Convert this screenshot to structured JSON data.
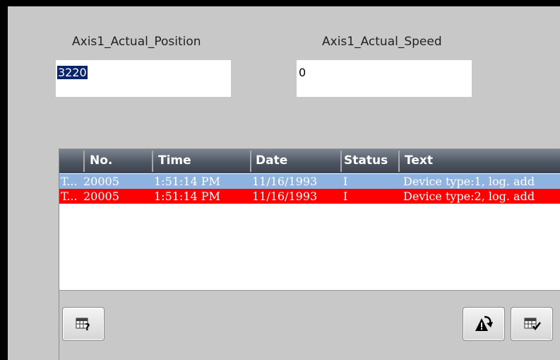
{
  "fields": {
    "position": {
      "label": "Axis1_Actual_Position",
      "value": "3220"
    },
    "speed": {
      "label": "Axis1_Actual_Speed",
      "value": "0"
    }
  },
  "alarm_view": {
    "columns": [
      "No.",
      "Time",
      "Date",
      "Status",
      "Text"
    ],
    "rows": [
      {
        "type": "T...",
        "no": "20005",
        "time": "1:51:14 PM",
        "date": "11/16/1993",
        "status": "I",
        "text": "Device type:1, log. add"
      },
      {
        "type": "T...",
        "no": "20005",
        "time": "1:51:14 PM",
        "date": "11/16/1993",
        "status": "I",
        "text": "Device type:2, log. add"
      }
    ],
    "buttons": {
      "info": "table-help-icon",
      "acknowledge": "acknowledge-icon",
      "edit": "table-edit-icon"
    }
  },
  "colors": {
    "background": "#c8c8c8",
    "header": "#4e5661",
    "row_selected": "#8eb3e0",
    "row_alarm": "#ff0000",
    "value_highlight": "#0a246a"
  }
}
